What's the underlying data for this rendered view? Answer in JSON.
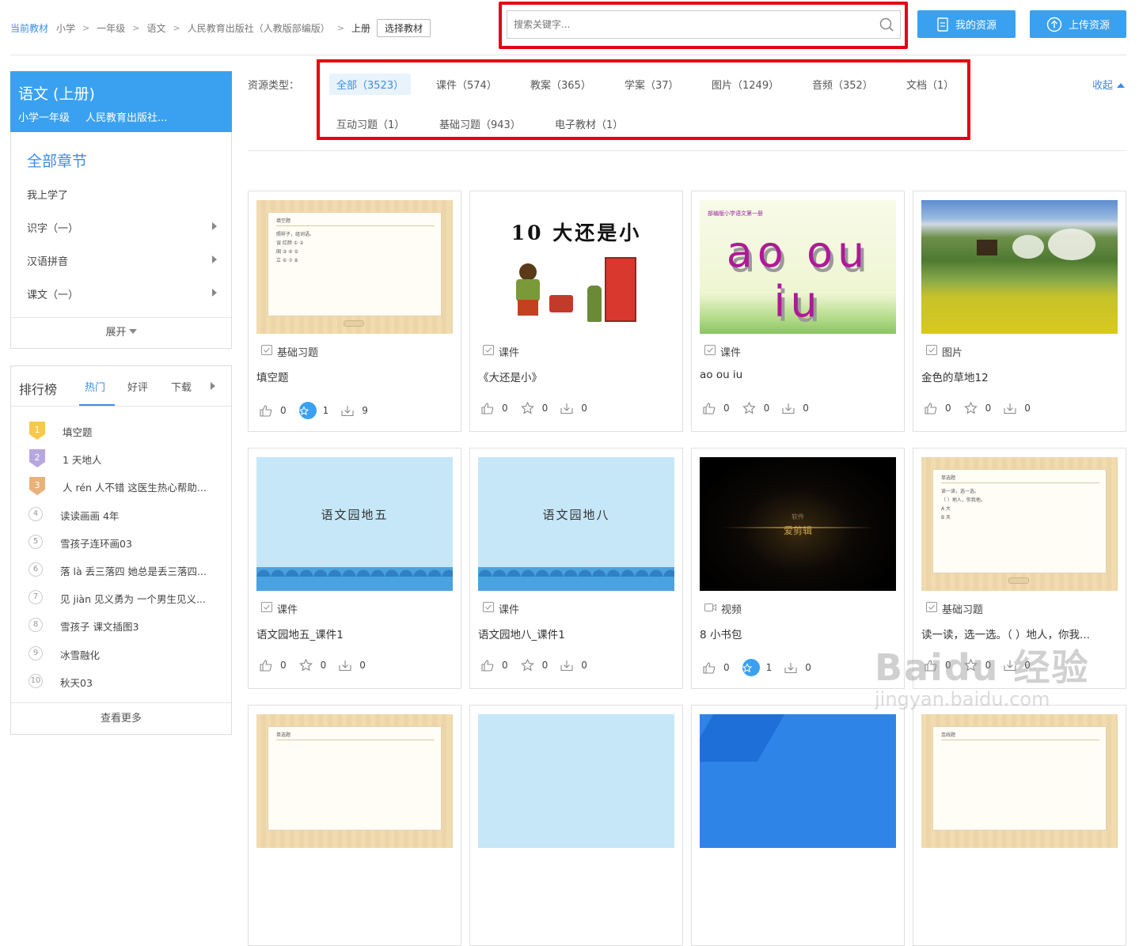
{
  "breadcrumb": {
    "items": [
      "当前教材",
      "小学",
      "一年级",
      "语文",
      "人民教育出版社（人教版部编版）",
      "上册"
    ],
    "separator": ">",
    "select_button": "选择教材"
  },
  "search": {
    "placeholder": "搜索关键字..."
  },
  "header_buttons": {
    "my_resources": "我的资源",
    "upload": "上传资源"
  },
  "book": {
    "title": "语文 (上册)",
    "grade": "小学一年级",
    "publisher": "人民教育出版社..."
  },
  "chapters": {
    "all_label": "全部章节",
    "items": [
      "我上学了",
      "识字（一）",
      "汉语拼音",
      "课文（一）"
    ],
    "expand_label": "展开"
  },
  "ranking": {
    "title": "排行榜",
    "tabs": [
      "热门",
      "好评",
      "下载"
    ],
    "items": [
      {
        "rank": "1",
        "title": "填空题"
      },
      {
        "rank": "2",
        "title": "1 天地人"
      },
      {
        "rank": "3",
        "title": "人 rén 人不错 这医生热心帮助..."
      },
      {
        "rank": "4",
        "title": "读读画画 4年"
      },
      {
        "rank": "5",
        "title": "雪孩子连环画03"
      },
      {
        "rank": "6",
        "title": "落 là 丢三落四 她总是丢三落四..."
      },
      {
        "rank": "7",
        "title": "见 jiàn 见义勇为 一个男生见义..."
      },
      {
        "rank": "8",
        "title": "雪孩子 课文插图3"
      },
      {
        "rank": "9",
        "title": "冰雪融化"
      },
      {
        "rank": "10",
        "title": "秋天03"
      }
    ],
    "more_label": "查看更多"
  },
  "resource_types": {
    "label": "资源类型：",
    "items": [
      "全部（3523）",
      "课件（574）",
      "教案（365）",
      "学案（37）",
      "图片（1249）",
      "音频（352）",
      "文档（1）",
      "互动习题（1）",
      "基础习题（943）",
      "电子教材（1）"
    ],
    "collapse_label": "收起"
  },
  "cards": [
    {
      "type": "基础习题",
      "title": "填空题",
      "likes": "0",
      "favorites": "1",
      "downloads": "9",
      "thumb_caption": "填空题",
      "thumb_lines": [
        "照样子，组词语。",
        "误 红颜 ① ②",
        "国 ③ ④ ⑤",
        "立 ⑥ ⑦ ⑧"
      ]
    },
    {
      "type": "课件",
      "title": "《大还是小》",
      "likes": "0",
      "favorites": "0",
      "downloads": "0",
      "thumb_caption": "10  大还是小"
    },
    {
      "type": "课件",
      "title": "ao ou iu",
      "likes": "0",
      "favorites": "0",
      "downloads": "0",
      "thumb_caption": "部编版小学语文第一册",
      "thumb_big": "ao ou iu"
    },
    {
      "type": "图片",
      "title": "金色的草地12",
      "likes": "0",
      "favorites": "0",
      "downloads": "0"
    },
    {
      "type": "课件",
      "title": "语文园地五_课件1",
      "likes": "0",
      "favorites": "0",
      "downloads": "0",
      "thumb_caption": "语文园地五"
    },
    {
      "type": "课件",
      "title": "语文园地八_课件1",
      "likes": "0",
      "favorites": "0",
      "downloads": "0",
      "thumb_caption": "语文园地八"
    },
    {
      "type": "视频",
      "title": "8 小书包",
      "likes": "0",
      "favorites": "1",
      "downloads": "0",
      "thumb_caption": "软件",
      "thumb_big": "爱剪辑"
    },
    {
      "type": "基础习题",
      "title": "读一读，选一选。（ ）地人，你我...",
      "likes": "0",
      "favorites": "0",
      "downloads": "0",
      "thumb_caption": "单选题",
      "thumb_lines": [
        "读一读，选一选。",
        "（ ）地人，你我他。",
        "A 大",
        "B 天"
      ]
    }
  ],
  "partial_cards": [
    {
      "thumb_caption": "单选题"
    },
    {
      "thumb_caption": ""
    },
    {
      "thumb_caption": ""
    },
    {
      "thumb_caption": "连线题"
    }
  ],
  "watermark": {
    "logo": "Baidu 经验",
    "url": "jingyan.baidu.com"
  },
  "colors": {
    "accent": "#3aa1f0",
    "link": "#3a8ee6",
    "highlight": "#e60012"
  }
}
